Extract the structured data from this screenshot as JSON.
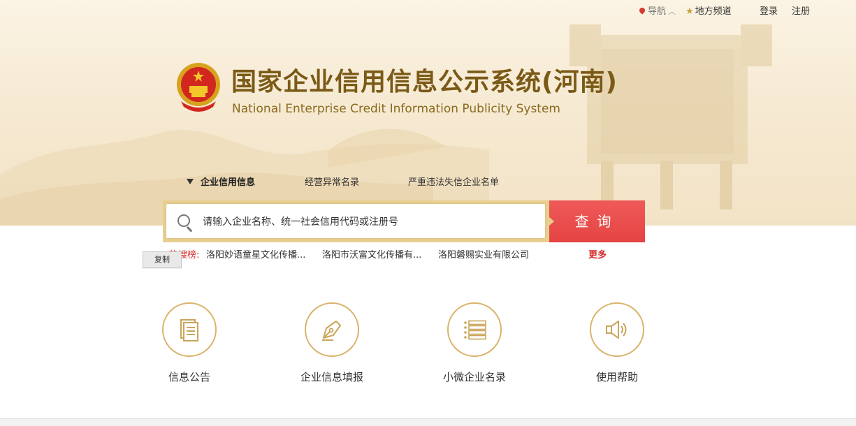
{
  "topnav": {
    "guide": "导航",
    "local": "地方频道",
    "login": "登录",
    "register": "注册"
  },
  "header": {
    "title_cn": "国家企业信用信息公示系统(河南)",
    "title_en": "National Enterprise Credit Information Publicity System"
  },
  "tabs": [
    {
      "label": "企业信用信息"
    },
    {
      "label": "经营异常名录"
    },
    {
      "label": "严重违法失信企业名单"
    }
  ],
  "search": {
    "placeholder": "请输入企业名称、统一社会信用代码或注册号",
    "button_label": "查询"
  },
  "hot": {
    "label": "热搜榜:",
    "items": [
      "洛阳妙语童星文化传播...",
      "洛阳市沃富文化传播有...",
      "洛阳磐赐实业有限公司"
    ],
    "more": "更多"
  },
  "copy_button": "复制",
  "features": [
    {
      "label": "信息公告",
      "icon": "document-icon"
    },
    {
      "label": "企业信息填报",
      "icon": "pen-nib-icon"
    },
    {
      "label": "小微企业名录",
      "icon": "list-icon"
    },
    {
      "label": "使用帮助",
      "icon": "speaker-icon"
    }
  ],
  "colors": {
    "accent_red": "#e44443",
    "gold": "#d9b36a",
    "title_brown": "#7a5a16"
  }
}
